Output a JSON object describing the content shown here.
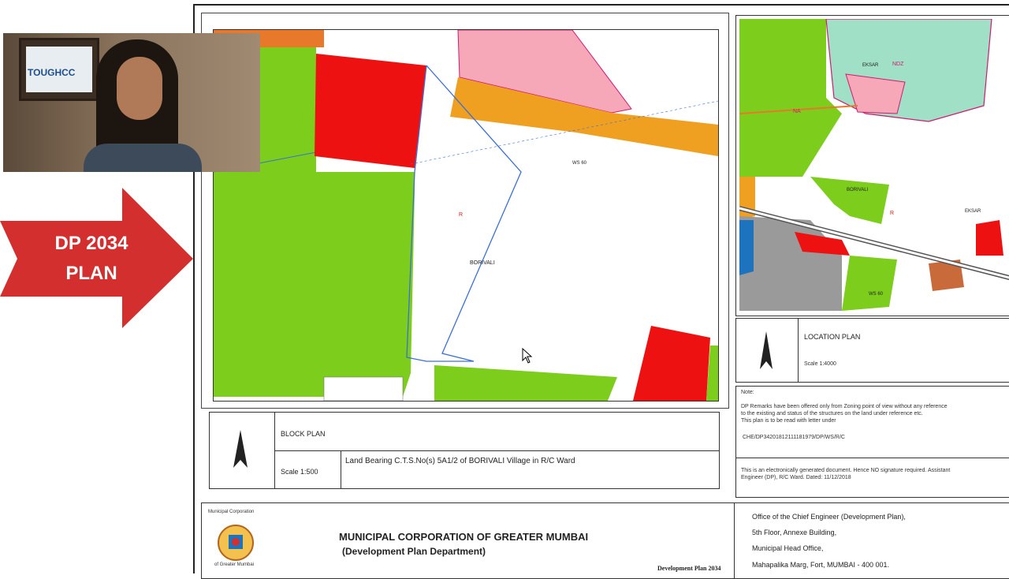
{
  "overlay": {
    "banner_line1": "DP 2034",
    "banner_line2": "PLAN",
    "banner_color": "#d32f2f",
    "webcam_logo_text": "TOUGHCC"
  },
  "map_labels": {
    "village_main": "BORIVALI",
    "zone_r": "R",
    "road_label": "WS 60",
    "loc_village_1": "EKSAR",
    "loc_zone": "NDZ",
    "loc_village_2": "EKSAR",
    "loc_borivali": "BORIVALI",
    "loc_na": "NA",
    "loc_r": "R",
    "loc_ws": "WS 60"
  },
  "block_plan": {
    "title": "BLOCK PLAN",
    "scale": "Scale 1:500",
    "land_text": "Land Bearing C.T.S.No(s)  5A1/2 of BORIVALI Village in R/C Ward"
  },
  "location_plan": {
    "title": "LOCATION PLAN",
    "scale": "Scale 1:4000"
  },
  "notes": {
    "heading": "Note:",
    "line1": "DP Remarks have been offered only from Zoning point of view without any reference",
    "line2": "to the existing and status of the structures on the land under reference etc.",
    "line3": "This plan is to be read with letter under",
    "ref": "CHE/DP34201812111181979/DP/WS/R/C",
    "electronic1": "This is an electronically generated document. Hence NO signature required. Assistant",
    "electronic2": "Engineer (DP), R/C Ward. Dated: 11/12/2018"
  },
  "footer": {
    "org": "MUNICIPAL CORPORATION OF GREATER MUMBAI",
    "dept": "(Development Plan Department)",
    "addr1": "Office of the Chief Engineer (Development Plan),",
    "addr2": "5th Floor, Annexe Building,",
    "addr3": "Municipal Head Office,",
    "addr4": "Mahapalika Marg, Fort, MUMBAI - 400 001.",
    "plan_label": "Development Plan 2034",
    "seal_text_top": "Municipal Corporation",
    "seal_text_bottom": "of Greater Mumbai"
  },
  "colors": {
    "green_zone": "#7ccd1c",
    "red_zone": "#ee1111",
    "pink_zone": "#f7a8b8",
    "orange_zone": "#f0a020",
    "grey_zone": "#9a9a9a",
    "boundary_blue": "#3a6fd8"
  }
}
